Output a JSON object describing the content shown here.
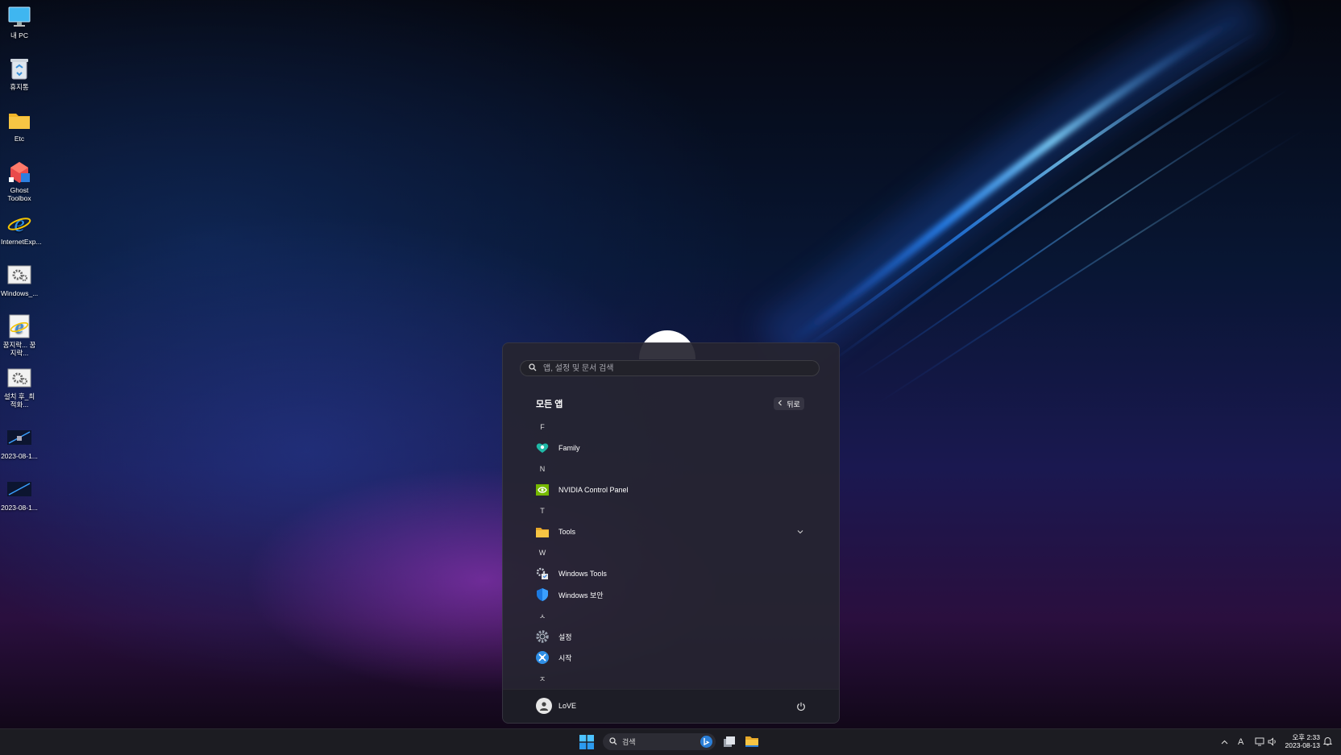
{
  "desktop": {
    "icons": [
      {
        "label": "내 PC",
        "icon": "monitor-icon"
      },
      {
        "label": "휴지통",
        "icon": "recycle-bin-icon"
      },
      {
        "label": "Etc",
        "icon": "folder-icon"
      },
      {
        "label": "Ghost Toolbox",
        "icon": "ghost-toolbox-icon"
      },
      {
        "label": "InternetExp...",
        "icon": "internet-explorer-icon"
      },
      {
        "label": "Windows_...",
        "icon": "settings-shortcut-icon"
      },
      {
        "label": "꿈지락... 꿈지락...",
        "icon": "internet-explorer-shortcut-icon"
      },
      {
        "label": "설치 후_최적화...",
        "icon": "settings-shortcut-icon"
      },
      {
        "label": "2023-08-1...",
        "icon": "screenshot-thumbnail-icon"
      },
      {
        "label": "2023-08-1...",
        "icon": "screenshot-thumbnail-icon"
      }
    ]
  },
  "start_menu": {
    "search_placeholder": "앱, 설정 및 문서 검색",
    "section_title": "모든 앱",
    "back_label": "뒤로",
    "groups": [
      {
        "letter": "F",
        "apps": [
          {
            "name": "Family",
            "icon": "family-heart-icon"
          }
        ]
      },
      {
        "letter": "N",
        "apps": [
          {
            "name": "NVIDIA Control Panel",
            "icon": "nvidia-icon"
          }
        ]
      },
      {
        "letter": "T",
        "apps": [
          {
            "name": "Tools",
            "icon": "folder-icon",
            "expandable": true
          }
        ]
      },
      {
        "letter": "W",
        "apps": [
          {
            "name": "Windows Tools",
            "icon": "windows-tools-icon"
          },
          {
            "name": "Windows 보안",
            "icon": "shield-icon"
          }
        ]
      },
      {
        "letter": "ㅅ",
        "apps": [
          {
            "name": "설정",
            "icon": "gear-icon"
          },
          {
            "name": "시작",
            "icon": "tips-icon"
          }
        ]
      },
      {
        "letter": "ㅈ",
        "apps": []
      }
    ],
    "user_name": "LoVE"
  },
  "taskbar": {
    "search_label": "검색",
    "clock_time": "오후 2:33",
    "clock_date": "2023-08-13",
    "ime_label": "A"
  },
  "colors": {
    "accent_blue": "#3aa0ff",
    "folder_yellow": "#f7c544",
    "nvidia_green": "#76b900"
  }
}
